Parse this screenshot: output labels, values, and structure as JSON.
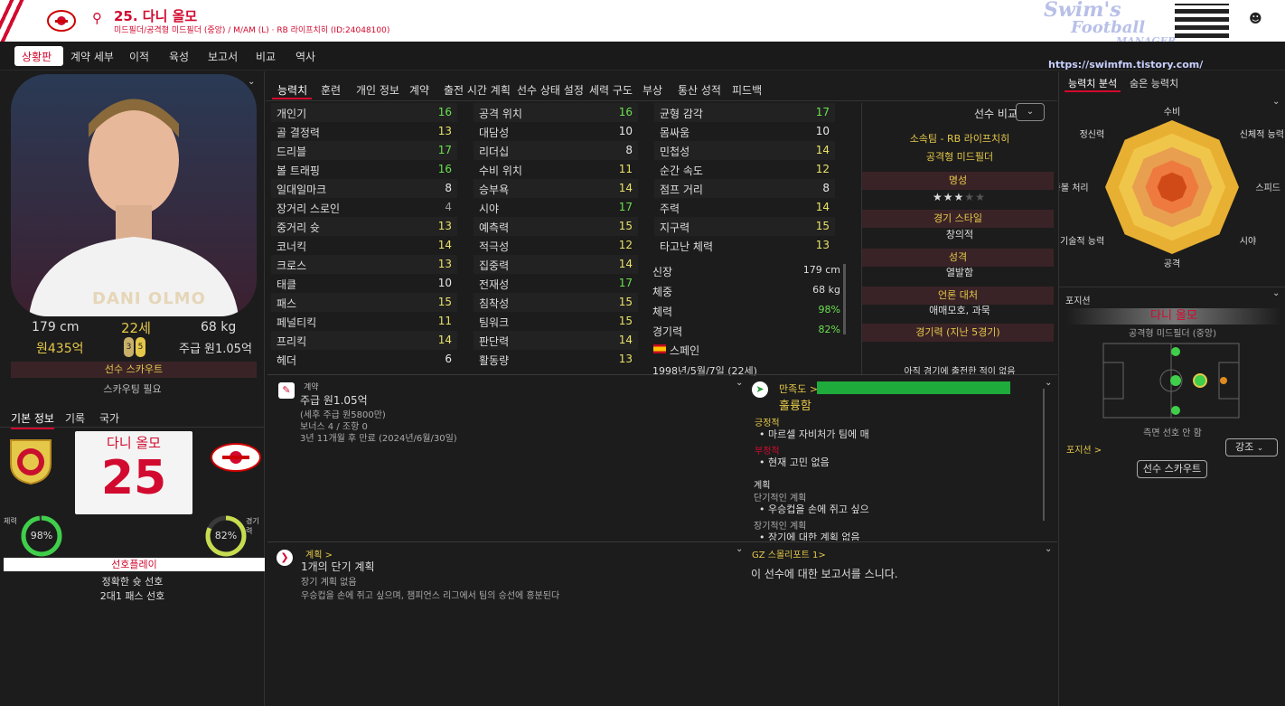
{
  "header": {
    "title": "25. 다니 올모",
    "subtitle": "미드필더/공격형 미드필더 (중앙) / M/AM (L) · RB 라이프치히 (ID:24048100)",
    "watermark_url": "https://swimfm.tistory.com/",
    "logo_line1": "Swim's",
    "logo_line2": "Football",
    "logo_line3": "MANAGER"
  },
  "nav": [
    "상황판",
    "계약 세부",
    "이적",
    "육성",
    "보고서",
    "비교",
    "역사"
  ],
  "left": {
    "name_overlay": "DANI OLMO",
    "height": "179 cm",
    "age": "22세",
    "weight": "68 kg",
    "value": "원435억",
    "wage": "주급 원1.05억",
    "foot_left": "3",
    "foot_right": "5",
    "scout_btn": "선수 스카우트",
    "scout_note": "스카우팅 필요",
    "tabs": [
      "기본 정보",
      "기록",
      "국가"
    ],
    "shirt_name": "다니 올모",
    "shirt_number": "25",
    "cond_label": "체력",
    "cond_value": "98%",
    "sharp_label": "경기력",
    "sharp_value": "82%",
    "play_title": "선호플레이",
    "plays": [
      "정확한 슛 선호",
      "2대1 패스 선호"
    ]
  },
  "tabs": [
    "능력치",
    "훈련",
    "개인 정보",
    "계약",
    "출전 시간 계획",
    "선수 상태 설정",
    "세력 구도",
    "부상",
    "통산 성적",
    "피드백"
  ],
  "attributes": {
    "col1": [
      [
        "개인기",
        "16"
      ],
      [
        "골 결정력",
        "13"
      ],
      [
        "드리블",
        "17"
      ],
      [
        "볼 트래핑",
        "16"
      ],
      [
        "일대일마크",
        "8"
      ],
      [
        "장거리 스로인",
        "4"
      ],
      [
        "중거리 슛",
        "13"
      ],
      [
        "코너킥",
        "14"
      ],
      [
        "크로스",
        "13"
      ],
      [
        "태클",
        "10"
      ],
      [
        "패스",
        "15"
      ],
      [
        "페널티킥",
        "11"
      ],
      [
        "프리킥",
        "14"
      ],
      [
        "헤더",
        "6"
      ]
    ],
    "col2": [
      [
        "공격 위치",
        "16"
      ],
      [
        "대담성",
        "10"
      ],
      [
        "리더십",
        "8"
      ],
      [
        "수비 위치",
        "11"
      ],
      [
        "승부욕",
        "14"
      ],
      [
        "시야",
        "17"
      ],
      [
        "예측력",
        "15"
      ],
      [
        "적극성",
        "12"
      ],
      [
        "집중력",
        "14"
      ],
      [
        "전재성",
        "17"
      ],
      [
        "침착성",
        "15"
      ],
      [
        "팀워크",
        "15"
      ],
      [
        "판단력",
        "14"
      ],
      [
        "활동량",
        "13"
      ]
    ],
    "col3": [
      [
        "균형 감각",
        "17"
      ],
      [
        "몸싸움",
        "10"
      ],
      [
        "민첩성",
        "14"
      ],
      [
        "순간 속도",
        "12"
      ],
      [
        "점프 거리",
        "8"
      ],
      [
        "주력",
        "14"
      ],
      [
        "지구력",
        "15"
      ],
      [
        "타고난 체력",
        "13"
      ]
    ]
  },
  "info": [
    [
      "신장",
      "179 cm"
    ],
    [
      "체중",
      "68 kg"
    ],
    [
      "체력",
      "98%"
    ],
    [
      "경기력",
      "82%"
    ]
  ],
  "nation": "스페인",
  "dob": "1998년/5월/7일 (22세)",
  "side": {
    "compare_label": "선수 비교",
    "club": "소속팀 - RB 라이프치히",
    "role": "공격형 미드필더",
    "rep_label": "명성",
    "stars_filled": 3,
    "stars_total": 5,
    "style_label": "경기 스타일",
    "style": "창의적",
    "personality_label": "성격",
    "personality": "열발함",
    "media_label": "언론 대처",
    "media": "애매모호, 과묵",
    "form_label": "경기력 (지난 5경기)",
    "form_note": "아직 경기에 출전한 적이 없음"
  },
  "contract": {
    "label": "계약",
    "wage": "주급 원1.05억",
    "aftertax": "(세후 주급 원5800만)",
    "bonus": "보너스 4 / 조항 0",
    "expiry": "3년 11개월 후 만료 (2024년/6월/30일)"
  },
  "happiness": {
    "label": "만족도 >",
    "value": "훌륭함",
    "positive_label": "긍정적",
    "positive": "마르셀 자비처가 팀에 매",
    "negative_label": "부정적",
    "negative": "현재 고민 없음",
    "plans_label": "계획",
    "short_label": "단기적인 계획",
    "short": "우승컵을 손에 쥐고 싶으",
    "long_label": "장기적인 계획",
    "long": "장기에 대한 계획 없음"
  },
  "plan": {
    "label": "계획 >",
    "title": "1개의 단기 계획",
    "sub": "장기 계획 없음",
    "desc": "우승컵을 손에 쥐고 싶으며, 챔피언스 리그에서 팀의 승선에 흥분된다"
  },
  "report": {
    "label": "GZ 스몰리포트 1>",
    "text": "이 선수에 대한 보고서를 스니다."
  },
  "analysis": {
    "tabs": [
      "능력치 분석",
      "숨은 능력치"
    ],
    "axes": [
      "수비",
      "신체적 능력",
      "스피드",
      "시야",
      "공격",
      "기술적 능력",
      "공중볼 처리",
      "정신력"
    ]
  },
  "position": {
    "label": "포지션",
    "name": "다니 올모",
    "role": "공격형 미드필더 (중앙)",
    "pref": "측면 선호 안 함",
    "pos_label": "포지션 >",
    "emph": "강조",
    "scout_btn": "선수 스카우트"
  },
  "colors": {
    "accent": "#d20a2f",
    "green": "#6be04f",
    "yellow": "#e8e26a",
    "gold": "#e5c84a"
  }
}
